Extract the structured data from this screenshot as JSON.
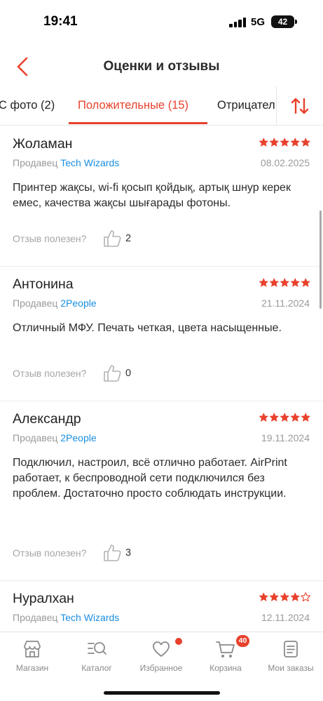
{
  "status_bar": {
    "time": "19:41",
    "network": "5G",
    "battery": "42"
  },
  "header": {
    "title": "Оценки и отзывы",
    "back_icon": "chevron-left-icon"
  },
  "tabs": [
    {
      "label": "С фото (2)",
      "active": false
    },
    {
      "label": "Положительные (15)",
      "active": true
    },
    {
      "label": "Отрицател",
      "active": false
    }
  ],
  "sort_icon": "sort-arrows-icon",
  "helpful_label": "Отзыв полезен?",
  "seller_prefix": "Продавец",
  "reviews": [
    {
      "name": "Жоламан",
      "rating": 5,
      "seller": "Tech Wizards",
      "date": "08.02.2025",
      "text": "Принтер жақсы, wi-fi қосып қойдық, артық шнур керек емес, качества жақсы шығарады фотоны.",
      "helpful": "2"
    },
    {
      "name": "Антонина",
      "rating": 5,
      "seller": "2People",
      "date": "21.11.2024",
      "text": "Отличный МФУ. Печать четкая, цвета насыщенные.",
      "helpful": "0"
    },
    {
      "name": "Александр",
      "rating": 5,
      "seller": "2People",
      "date": "19.11.2024",
      "text": "Подключил, настроил, всё отлично работает. AirPrint работает, к беспроводной сети подключился без проблем. Достаточно просто соблюдать инструкции.",
      "helpful": "3"
    },
    {
      "name": "Нуралхан",
      "rating": 4,
      "seller": "Tech Wizards",
      "date": "12.11.2024",
      "text": "",
      "helpful": ""
    }
  ],
  "bottom_nav": [
    {
      "label": "Магазин",
      "icon": "store-icon"
    },
    {
      "label": "Каталог",
      "icon": "catalog-search-icon"
    },
    {
      "label": "Избранное",
      "icon": "heart-icon",
      "dot": true
    },
    {
      "label": "Корзина",
      "icon": "cart-icon",
      "badge": "40"
    },
    {
      "label": "Мои заказы",
      "icon": "orders-icon"
    }
  ],
  "colors": {
    "accent": "#e8412c",
    "link": "#1a8ee0",
    "muted": "#9a9a9a"
  }
}
